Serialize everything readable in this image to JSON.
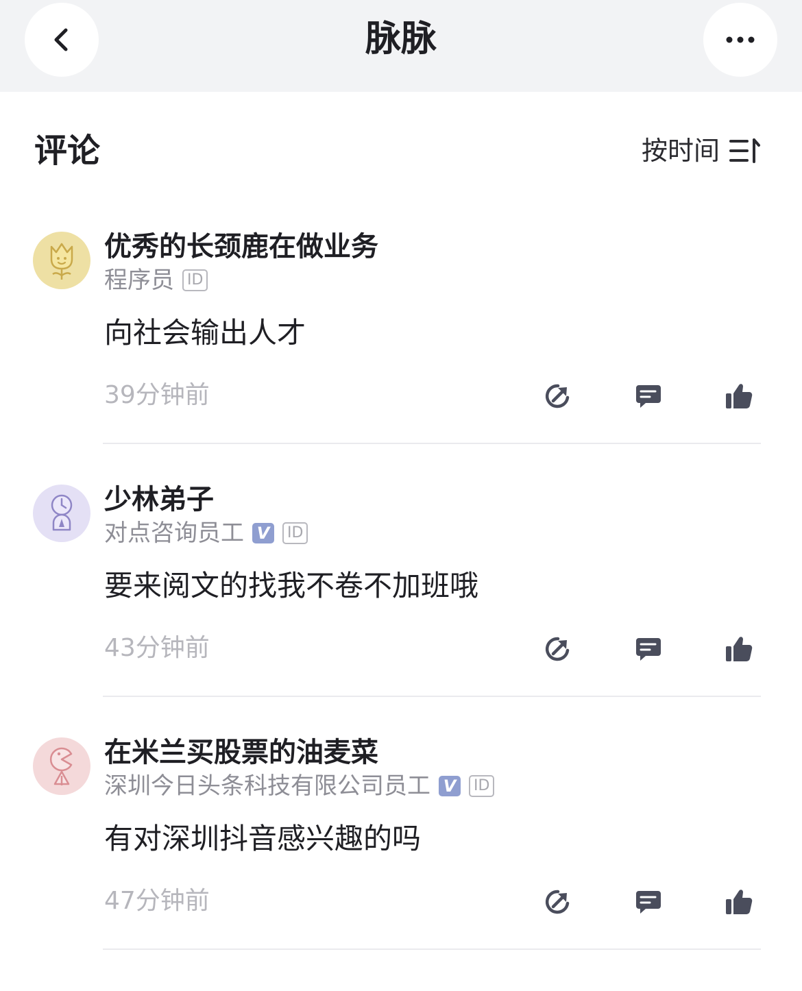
{
  "header": {
    "title": "脉脉",
    "back_icon": "chevron-left-icon",
    "more_icon": "more-dots-icon"
  },
  "section": {
    "title": "评论",
    "sort_label": "按时间",
    "sort_icon": "sort-icon"
  },
  "comments": [
    {
      "author": "优秀的长颈鹿在做业务",
      "title": "程序员",
      "verified": false,
      "id_badge": "ID",
      "content": "向社会输出人才",
      "time": "39分钟前",
      "avatar_color": "#eee0a4"
    },
    {
      "author": "少林弟子",
      "title": "对点咨询员工",
      "verified": true,
      "v_badge": "V",
      "id_badge": "ID",
      "content": "要来阅文的找我不卷不加班哦",
      "time": "43分钟前",
      "avatar_color": "#e4e0f5"
    },
    {
      "author": "在米兰买股票的油麦菜",
      "title": "深圳今日头条科技有限公司员工",
      "verified": true,
      "v_badge": "V",
      "id_badge": "ID",
      "content": "有对深圳抖音感兴趣的吗",
      "time": "47分钟前",
      "avatar_color": "#f4d9da"
    }
  ],
  "colors": {
    "header_bg": "#f2f3f5",
    "icon": "#4a4d5c",
    "verified_badge": "#8f9ed0",
    "muted_text": "#b6b6bc"
  }
}
